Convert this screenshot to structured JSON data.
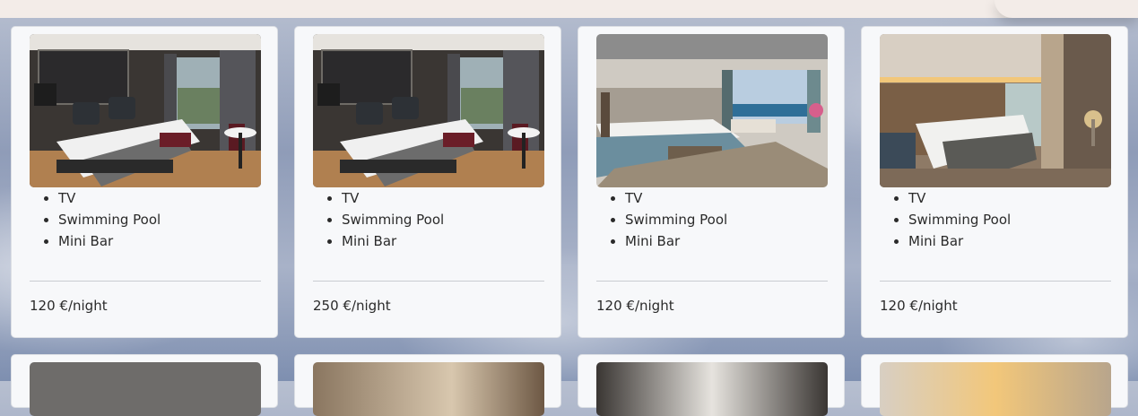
{
  "rooms": [
    {
      "amenities": [
        "TV",
        "Swimming Pool",
        "Mini Bar"
      ],
      "price": "120 €/night",
      "photo_icon": "twin-room-photo"
    },
    {
      "amenities": [
        "TV",
        "Swimming Pool",
        "Mini Bar"
      ],
      "price": "250 €/night",
      "photo_icon": "twin-room-photo"
    },
    {
      "amenities": [
        "TV",
        "Swimming Pool",
        "Mini Bar"
      ],
      "price": "120 €/night",
      "photo_icon": "sea-view-suite-photo"
    },
    {
      "amenities": [
        "TV",
        "Swimming Pool",
        "Mini Bar"
      ],
      "price": "120 €/night",
      "photo_icon": "warm-twin-room-photo"
    }
  ],
  "colors": {
    "card_bg": "#f7f8fa",
    "text": "#2a2a2a",
    "divider": "#c9ccd1",
    "topbar": "#f3ece8"
  }
}
